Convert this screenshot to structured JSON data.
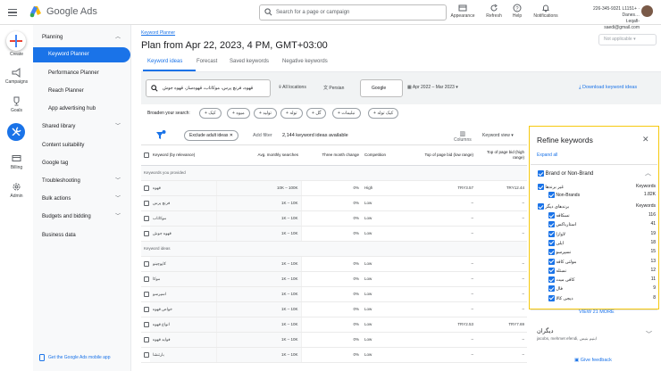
{
  "header": {
    "brand": "Google Ads",
    "search_placeholder": "Search for a page or campaign",
    "tools": [
      {
        "label": "Appearance",
        "icon": "appearance-icon"
      },
      {
        "label": "Refresh",
        "icon": "refresh-icon"
      },
      {
        "label": "Help",
        "icon": "help-icon"
      },
      {
        "label": "Notifications",
        "icon": "bell-icon"
      }
    ],
    "account_line1": "226-345-9321 L1151+ · Danes…",
    "account_line2": "t.eqafi-saedi@gmail.com"
  },
  "rail": [
    {
      "label": "Create",
      "icon": "plus-icon"
    },
    {
      "label": "Campaigns",
      "icon": "campaigns-icon"
    },
    {
      "label": "Goals",
      "icon": "trophy-icon"
    },
    {
      "label": "Tools",
      "icon": "tools-icon"
    },
    {
      "label": "Billing",
      "icon": "billing-icon"
    },
    {
      "label": "Admin",
      "icon": "admin-gear-icon"
    }
  ],
  "nav": {
    "section": "Planning",
    "items": [
      {
        "label": "Keyword Planner",
        "active": true
      },
      {
        "label": "Performance Planner"
      },
      {
        "label": "Reach Planner"
      },
      {
        "label": "App advertising hub"
      }
    ],
    "groups": [
      {
        "label": "Shared library",
        "chev": true
      },
      {
        "label": "Content suitability",
        "chev": false
      },
      {
        "label": "Google tag",
        "chev": false
      },
      {
        "label": "Troubleshooting",
        "chev": true
      },
      {
        "label": "Bulk actions",
        "chev": true
      },
      {
        "label": "Budgets and bidding",
        "chev": true
      },
      {
        "label": "Business data",
        "chev": false
      }
    ],
    "app_link": "Get the Google Ads mobile app"
  },
  "main": {
    "breadcrumb": "Keyword Planner",
    "title": "Plan from Apr 22, 2023, 4 PM, GMT+03:00",
    "applicability": "Not applicable",
    "tabs": [
      "Keyword ideas",
      "Forecast",
      "Saved keywords",
      "Negative keywords"
    ],
    "search_value": "قهوه، فرنچ پرس، موکاتاب، قهوه‌ساز، قهوه جوش",
    "locations": "All locations",
    "language": "Persian",
    "network": "Google",
    "date_range": "Apr 2022 – Mar 2023",
    "download": "Download keyword ideas",
    "broaden_label": "Broaden your search:",
    "broaden_chips": [
      "کیک توله",
      "نبلیمات",
      "گل",
      "توله",
      "تولید",
      "میوه",
      "کیک"
    ],
    "exclude_adult": "Exclude adult ideas",
    "add_filter": "Add filter",
    "ideas_count": "2,144 keyword ideas available",
    "columns_label": "Columns",
    "keyword_view": "Keyword view",
    "table": {
      "headers": [
        "Keyword (by relevance)",
        "Avg. monthly searches",
        "Three month change",
        "Competition",
        "Top of page bid (low range)",
        "Top of page bid (high range)"
      ],
      "group1": "Keywords you provided",
      "rows1": [
        {
          "kw": "قهوه",
          "avg": "10K – 100K",
          "chg": "0%",
          "comp": "High",
          "low": "TRY3.57",
          "high": "TRY12.44"
        },
        {
          "kw": "فرنچ پرس",
          "avg": "1K – 10K",
          "chg": "0%",
          "comp": "Low",
          "low": "–",
          "high": "–"
        },
        {
          "kw": "موکاتاب",
          "avg": "1K – 10K",
          "chg": "0%",
          "comp": "Low",
          "low": "–",
          "high": "–"
        },
        {
          "kw": "قهوه جوش",
          "avg": "1K – 10K",
          "chg": "0%",
          "comp": "Low",
          "low": "–",
          "high": "–"
        }
      ],
      "group2": "Keyword ideas",
      "rows2": [
        {
          "kw": "کاپوچینو",
          "avg": "1K – 10K",
          "chg": "0%",
          "comp": "Low",
          "low": "–",
          "high": "–"
        },
        {
          "kw": "موکا",
          "avg": "1K – 10K",
          "chg": "0%",
          "comp": "Low",
          "low": "–",
          "high": "–"
        },
        {
          "kw": "اسپرسو",
          "avg": "1K – 10K",
          "chg": "0%",
          "comp": "Low",
          "low": "–",
          "high": "–"
        },
        {
          "kw": "خواص قهوه",
          "avg": "1K – 10K",
          "chg": "0%",
          "comp": "Low",
          "low": "–",
          "high": "–"
        },
        {
          "kw": "انواع قهوه",
          "avg": "1K – 10K",
          "chg": "0%",
          "comp": "Low",
          "low": "TRY2.53",
          "high": "TRY7.69"
        },
        {
          "kw": "فواید قهوه",
          "avg": "1K – 10K",
          "chg": "0%",
          "comp": "Low",
          "low": "–",
          "high": "–"
        },
        {
          "kw": "بارتنشا",
          "avg": "1K – 10K",
          "chg": "0%",
          "comp": "Low",
          "low": "–",
          "high": "–"
        }
      ]
    }
  },
  "refine": {
    "title": "Refine keywords",
    "expand_all": "Expand all",
    "group_title": "Brand or Non-Brand",
    "sub1_label": "غیر برندها",
    "keywords_label": "Keywords",
    "sub1_items": [
      {
        "label": "Non-Brands",
        "count": "1.82K"
      }
    ],
    "sub2_label": "برندهای دیگر",
    "sub2_items": [
      {
        "label": "نسکافه",
        "count": "116"
      },
      {
        "label": "استارباکس",
        "count": "41"
      },
      {
        "label": "لاوازا",
        "count": "19"
      },
      {
        "label": "ایلی",
        "count": "18"
      },
      {
        "label": "نسپرسو",
        "count": "15"
      },
      {
        "label": "مولتی کافه",
        "count": "13"
      },
      {
        "label": "نستله",
        "count": "12"
      },
      {
        "label": "کافی میت",
        "count": "11"
      },
      {
        "label": "فال",
        "count": "9"
      },
      {
        "label": "دیجی کالا",
        "count": "8"
      }
    ],
    "view_more": "VIEW 21 MORE",
    "other_title": "دیگران",
    "other_sub": "jacobs, mehmet efendi, ابنیم بنیس",
    "feedback": "Give feedback"
  }
}
